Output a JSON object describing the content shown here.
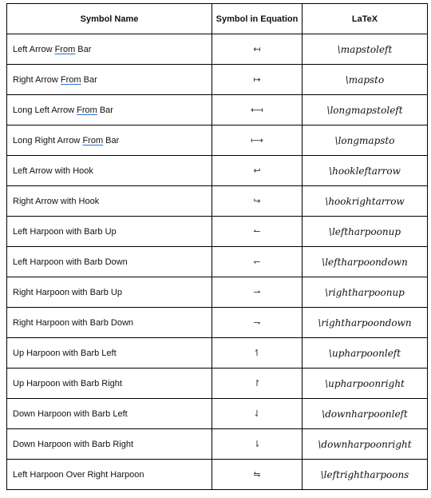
{
  "table": {
    "headers": [
      "Symbol Name",
      "Symbol in Equation",
      "LaTeX"
    ],
    "rows": [
      {
        "name": [
          "Left Arrow ",
          "From",
          " Bar"
        ],
        "symbol": "↤",
        "latex": "\\mapstoleft"
      },
      {
        "name": [
          "Right Arrow ",
          "From",
          " Bar"
        ],
        "symbol": "↦",
        "latex": "\\mapsto"
      },
      {
        "name": [
          "Long Left Arrow ",
          "From",
          " Bar"
        ],
        "symbol": "⟻",
        "latex": "\\longmapstoleft"
      },
      {
        "name": [
          "Long Right Arrow ",
          "From",
          " Bar"
        ],
        "symbol": "⟼",
        "latex": "\\longmapsto"
      },
      {
        "name": [
          "Left Arrow with Hook",
          "",
          ""
        ],
        "symbol": "↩",
        "latex": "\\hookleftarrow"
      },
      {
        "name": [
          "Right Arrow with Hook",
          "",
          ""
        ],
        "symbol": "↪",
        "latex": "\\hookrightarrow"
      },
      {
        "name": [
          "Left Harpoon with Barb Up",
          "",
          ""
        ],
        "symbol": "↼",
        "latex": "\\leftharpoonup"
      },
      {
        "name": [
          "Left Harpoon with Barb Down",
          "",
          ""
        ],
        "symbol": "↽",
        "latex": "\\leftharpoondown"
      },
      {
        "name": [
          "Right Harpoon with Barb Up",
          "",
          ""
        ],
        "symbol": "⇀",
        "latex": "\\rightharpoonup"
      },
      {
        "name": [
          "Right Harpoon with Barb Down",
          "",
          ""
        ],
        "symbol": "⇁",
        "latex": "\\rightharpoondown"
      },
      {
        "name": [
          "Up Harpoon with Barb Left",
          "",
          ""
        ],
        "symbol": "↿",
        "latex": "\\upharpoonleft"
      },
      {
        "name": [
          "Up Harpoon with Barb Right",
          "",
          ""
        ],
        "symbol": "↾",
        "latex": "\\upharpoonright"
      },
      {
        "name": [
          "Down Harpoon with Barb Left",
          "",
          ""
        ],
        "symbol": "⇃",
        "latex": "\\downharpoonleft"
      },
      {
        "name": [
          "Down Harpoon with Barb Right",
          "",
          ""
        ],
        "symbol": "⇂",
        "latex": "\\downharpoonright"
      },
      {
        "name": [
          "Left Harpoon Over Right Harpoon",
          "",
          ""
        ],
        "symbol": "⇋",
        "latex": "\\leftrightharpoons"
      }
    ]
  }
}
